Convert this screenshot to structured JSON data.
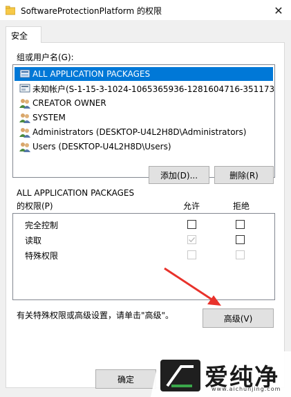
{
  "window": {
    "title": "SoftwareProtectionPlatform 的权限",
    "close_glyph": "✕"
  },
  "tabs": [
    {
      "label": "安全"
    }
  ],
  "groups_label": "组或用户名(G):",
  "principals": [
    {
      "label": "ALL APPLICATION PACKAGES",
      "icon": "app-packages-icon",
      "selected": true
    },
    {
      "label": "未知帐户(S-1-15-3-1024-1065365936-1281604716-351173...",
      "icon": "unknown-account-icon",
      "selected": false
    },
    {
      "label": "CREATOR OWNER",
      "icon": "users-icon",
      "selected": false
    },
    {
      "label": "SYSTEM",
      "icon": "users-icon",
      "selected": false
    },
    {
      "label": "Administrators (DESKTOP-U4L2H8D\\Administrators)",
      "icon": "users-icon",
      "selected": false
    },
    {
      "label": "Users (DESKTOP-U4L2H8D\\Users)",
      "icon": "users-icon",
      "selected": false
    }
  ],
  "buttons": {
    "add": "添加(D)...",
    "remove": "删除(R)",
    "advanced": "高级(V)",
    "ok": "确定"
  },
  "permissions": {
    "for_label_line1": "ALL APPLICATION PACKAGES",
    "for_label_line2": "的权限(P)",
    "allow_header": "允许",
    "deny_header": "拒绝",
    "rows": [
      {
        "name": "完全控制",
        "allow": false,
        "allow_disabled": false,
        "deny": false,
        "deny_disabled": false
      },
      {
        "name": "读取",
        "allow": true,
        "allow_disabled": true,
        "deny": false,
        "deny_disabled": false
      },
      {
        "name": "特殊权限",
        "allow": false,
        "allow_disabled": true,
        "deny": false,
        "deny_disabled": true
      }
    ]
  },
  "advanced_hint": "有关特殊权限或高级设置，请单击\"高级\"。",
  "watermark": {
    "brand": "爱纯净",
    "url": "www.aichunjing.com"
  },
  "colors": {
    "selection": "#0078d7",
    "arrow": "#e8322b",
    "dialog_bg": "#f0f0f0"
  }
}
